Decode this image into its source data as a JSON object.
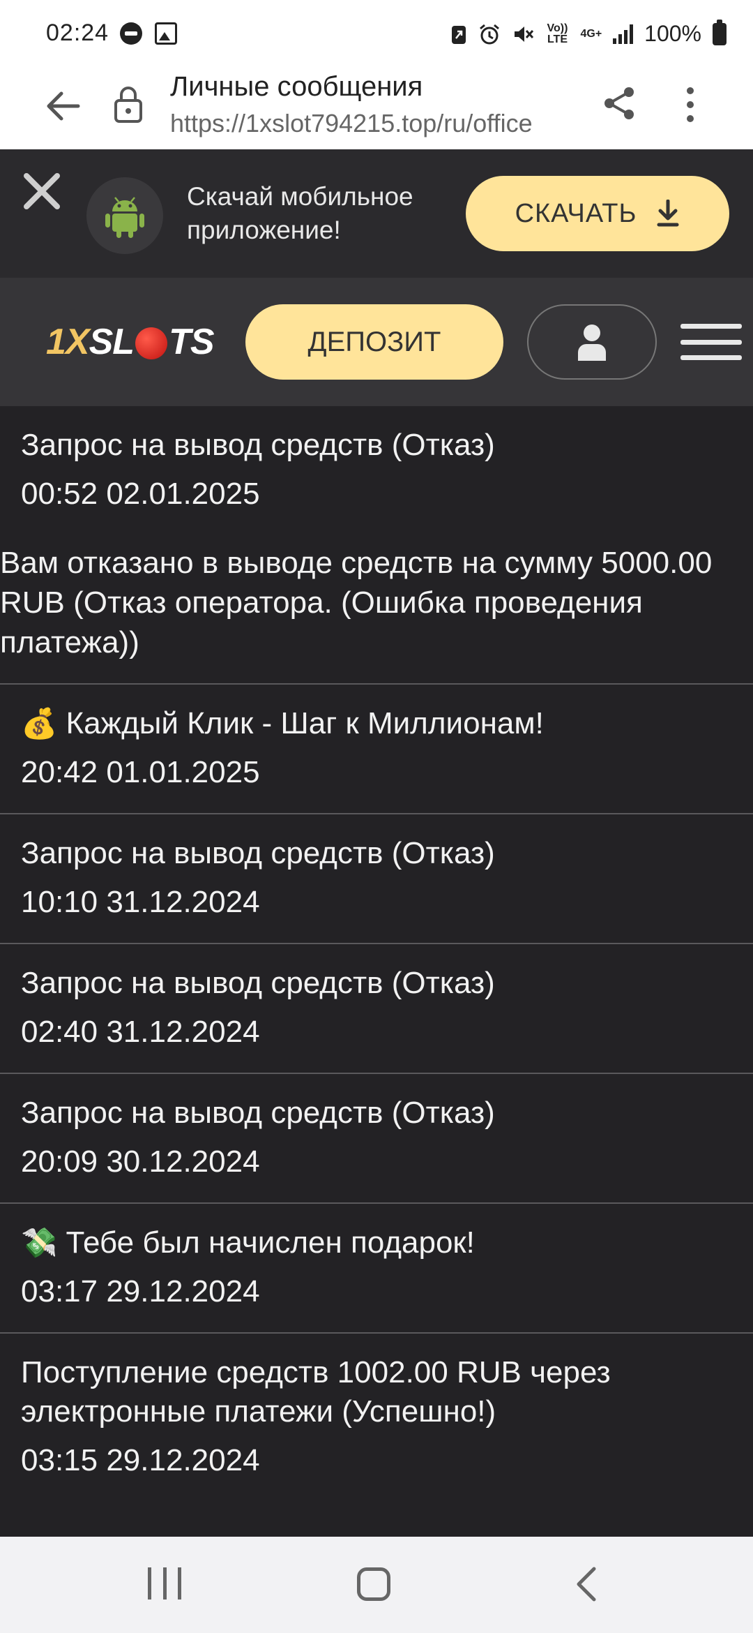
{
  "status_bar": {
    "time": "02:24",
    "battery": "100%",
    "net_top": "Vo)) LTE",
    "net_4g": "4G+"
  },
  "browser": {
    "title": "Личные сообщения",
    "url": "https://1xslot794215.top/ru/office"
  },
  "app_banner": {
    "text": "Скачай мобильное приложение!",
    "download_label": "СКАЧАТЬ"
  },
  "header": {
    "logo_part1": "1X",
    "logo_part2": "SL",
    "logo_part3": "TS",
    "deposit_label": "ДЕПОЗИТ"
  },
  "messages": [
    {
      "emoji": "",
      "title": "Запрос на вывод средств (Отказ)",
      "date": "00:52 02.01.2025",
      "body": "Вам отказано в выводе средств на сумму 5000.00 RUB (Отказ оператора. (Ошибка проведения платежа))"
    },
    {
      "emoji": "💰",
      "title": "Каждый Клик - Шаг к Миллионам!",
      "date": "20:42 01.01.2025",
      "body": ""
    },
    {
      "emoji": "",
      "title": "Запрос на вывод средств (Отказ)",
      "date": "10:10 31.12.2024",
      "body": ""
    },
    {
      "emoji": "",
      "title": "Запрос на вывод средств (Отказ)",
      "date": "02:40 31.12.2024",
      "body": ""
    },
    {
      "emoji": "",
      "title": "Запрос на вывод средств (Отказ)",
      "date": "20:09 30.12.2024",
      "body": ""
    },
    {
      "emoji": "💸",
      "title": "Тебе был начислен подарок!",
      "date": "03:17 29.12.2024",
      "body": ""
    },
    {
      "emoji": "",
      "title": "Поступление средств 1002.00 RUB через электронные платежи (Успешно!)",
      "date": "03:15 29.12.2024",
      "body": ""
    }
  ],
  "colors": {
    "accent": "#ffe49a",
    "background": "#232225",
    "banner_bg": "#2b2a2d",
    "header_bg": "#363538",
    "logo_gold": "#f2c563"
  },
  "icons": {
    "status_left": [
      "dnd-icon",
      "image-icon"
    ],
    "status_right": [
      "battery-saver-icon",
      "alarm-icon",
      "mute-icon",
      "signal-icon",
      "battery-icon"
    ],
    "browser": [
      "back-arrow-icon",
      "lock-icon",
      "share-icon",
      "more-vert-icon"
    ],
    "banner": [
      "close-icon",
      "android-icon",
      "download-icon"
    ],
    "header": [
      "user-icon",
      "hamburger-menu-icon"
    ],
    "nav": [
      "recent-apps-icon",
      "home-icon",
      "back-icon"
    ]
  }
}
